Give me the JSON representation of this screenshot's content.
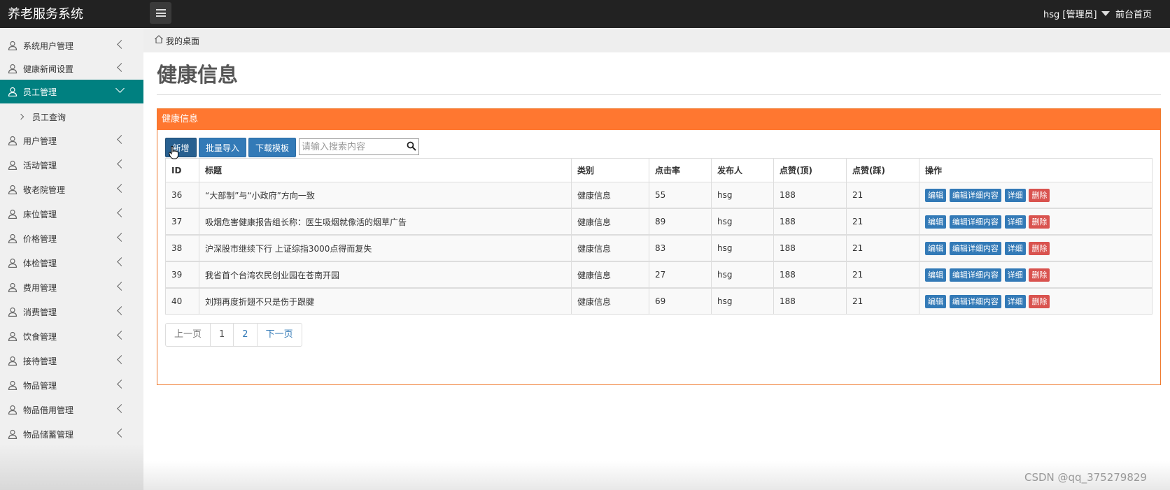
{
  "app": {
    "title": "养老服务系统",
    "user": "hsg [管理员]",
    "home_link": "前台首页"
  },
  "sidebar": {
    "items": [
      {
        "label": "系统用户管理"
      },
      {
        "label": "健康新闻设置"
      },
      {
        "label": "员工管理",
        "active": true
      },
      {
        "label": "用户管理"
      },
      {
        "label": "活动管理"
      },
      {
        "label": "敬老院管理"
      },
      {
        "label": "床位管理"
      },
      {
        "label": "价格管理"
      },
      {
        "label": "体检管理"
      },
      {
        "label": "费用管理"
      },
      {
        "label": "消费管理"
      },
      {
        "label": "饮食管理"
      },
      {
        "label": "接待管理"
      },
      {
        "label": "物品管理"
      },
      {
        "label": "物品借用管理"
      },
      {
        "label": "物品储蓄管理"
      }
    ],
    "sub_item": "员工查询"
  },
  "breadcrumb": "我的桌面",
  "page_title": "健康信息",
  "panel": {
    "title": "健康信息",
    "buttons": {
      "add": "新增",
      "import": "批量导入",
      "template": "下载模板"
    },
    "search_placeholder": "请输入搜索内容"
  },
  "table": {
    "headers": [
      "ID",
      "标题",
      "类别",
      "点击率",
      "发布人",
      "点赞(顶)",
      "点赞(踩)",
      "操作"
    ],
    "rows": [
      [
        "36",
        "“大部制”与“小政府”方向一致",
        "健康信息",
        "55",
        "hsg",
        "188",
        "21"
      ],
      [
        "37",
        "吸烟危害健康报告组长称：医生吸烟就像活的烟草广告",
        "健康信息",
        "89",
        "hsg",
        "188",
        "21"
      ],
      [
        "38",
        "沪深股市继续下行 上证综指3000点得而复失",
        "健康信息",
        "83",
        "hsg",
        "188",
        "21"
      ],
      [
        "39",
        "我省首个台湾农民创业园在苍南开园",
        "健康信息",
        "27",
        "hsg",
        "188",
        "21"
      ],
      [
        "40",
        "刘翔再度折翅不只是伤于跟腱",
        "健康信息",
        "69",
        "hsg",
        "188",
        "21"
      ]
    ],
    "actions": {
      "edit": "编辑",
      "edit_detail": "编辑详细内容",
      "detail": "详细",
      "delete": "删除"
    }
  },
  "pagination": {
    "prev": "上一页",
    "pages": [
      "1",
      "2"
    ],
    "next": "下一页"
  },
  "watermark": "CSDN @qq_375279829",
  "colors": {
    "topbar": "#222222",
    "active_nav": "#008080",
    "panel_header": "#ff7730",
    "primary": "#337ab7",
    "danger": "#d9534f"
  }
}
